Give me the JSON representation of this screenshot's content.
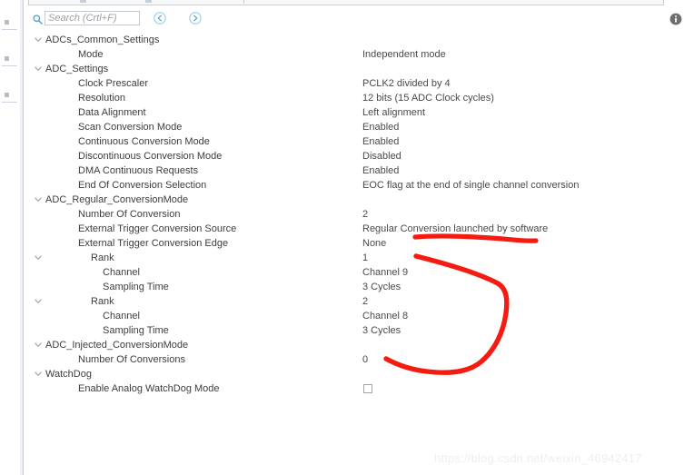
{
  "toolbar": {
    "search_icon": "search-icon",
    "search_placeholder": "Search (Crtl+F)",
    "search_value": "",
    "prev_label": "previous-match",
    "next_label": "next-match",
    "info_label": "information",
    "info_glyph": "i"
  },
  "tree": {
    "rows": [
      {
        "level": "group",
        "expandable": true,
        "label": "ADCs_Common_Settings",
        "value": ""
      },
      {
        "level": "item",
        "expandable": false,
        "label": "Mode",
        "value": "Independent mode"
      },
      {
        "level": "group",
        "expandable": true,
        "label": "ADC_Settings",
        "value": ""
      },
      {
        "level": "item",
        "expandable": false,
        "label": "Clock Prescaler",
        "value": "PCLK2 divided by 4"
      },
      {
        "level": "item",
        "expandable": false,
        "label": "Resolution",
        "value": "12 bits (15 ADC Clock cycles)"
      },
      {
        "level": "item",
        "expandable": false,
        "label": "Data Alignment",
        "value": "Left alignment"
      },
      {
        "level": "item",
        "expandable": false,
        "label": "Scan Conversion Mode",
        "value": "Enabled"
      },
      {
        "level": "item",
        "expandable": false,
        "label": "Continuous Conversion Mode",
        "value": "Enabled"
      },
      {
        "level": "item",
        "expandable": false,
        "label": "Discontinuous Conversion Mode",
        "value": "Disabled"
      },
      {
        "level": "item",
        "expandable": false,
        "label": "DMA Continuous Requests",
        "value": "Enabled"
      },
      {
        "level": "item",
        "expandable": false,
        "label": "End Of Conversion Selection",
        "value": "EOC flag at the end of single channel conversion"
      },
      {
        "level": "group",
        "expandable": true,
        "label": "ADC_Regular_ConversionMode",
        "value": ""
      },
      {
        "level": "item",
        "expandable": false,
        "label": "Number Of Conversion",
        "value": "2"
      },
      {
        "level": "item",
        "expandable": false,
        "label": "External Trigger Conversion Source",
        "value": "Regular Conversion launched by software"
      },
      {
        "level": "item",
        "expandable": false,
        "label": "External Trigger Conversion Edge",
        "value": "None"
      },
      {
        "level": "rank",
        "expandable": true,
        "label": "Rank",
        "value": "1"
      },
      {
        "level": "subitem",
        "expandable": false,
        "label": "Channel",
        "value": "Channel 9"
      },
      {
        "level": "subitem",
        "expandable": false,
        "label": "Sampling Time",
        "value": "3 Cycles"
      },
      {
        "level": "rank",
        "expandable": true,
        "label": "Rank",
        "value": "2"
      },
      {
        "level": "subitem",
        "expandable": false,
        "label": "Channel",
        "value": "Channel 8"
      },
      {
        "level": "subitem",
        "expandable": false,
        "label": "Sampling Time",
        "value": "3 Cycles"
      },
      {
        "level": "group",
        "expandable": true,
        "label": "ADC_Injected_ConversionMode",
        "value": ""
      },
      {
        "level": "item",
        "expandable": false,
        "label": "Number Of Conversions",
        "value": "0"
      },
      {
        "level": "group",
        "expandable": true,
        "label": "WatchDog",
        "value": ""
      },
      {
        "level": "item",
        "expandable": false,
        "label": "Enable Analog WatchDog Mode",
        "value": "",
        "checkbox": true,
        "checked": false
      }
    ]
  },
  "annotation": {
    "color": "#f41b10",
    "shapes": [
      "underline-stroke",
      "open-bracket-stroke"
    ]
  },
  "watermark": {
    "text": "https://blog.csdn.net/weixin_46942417"
  }
}
